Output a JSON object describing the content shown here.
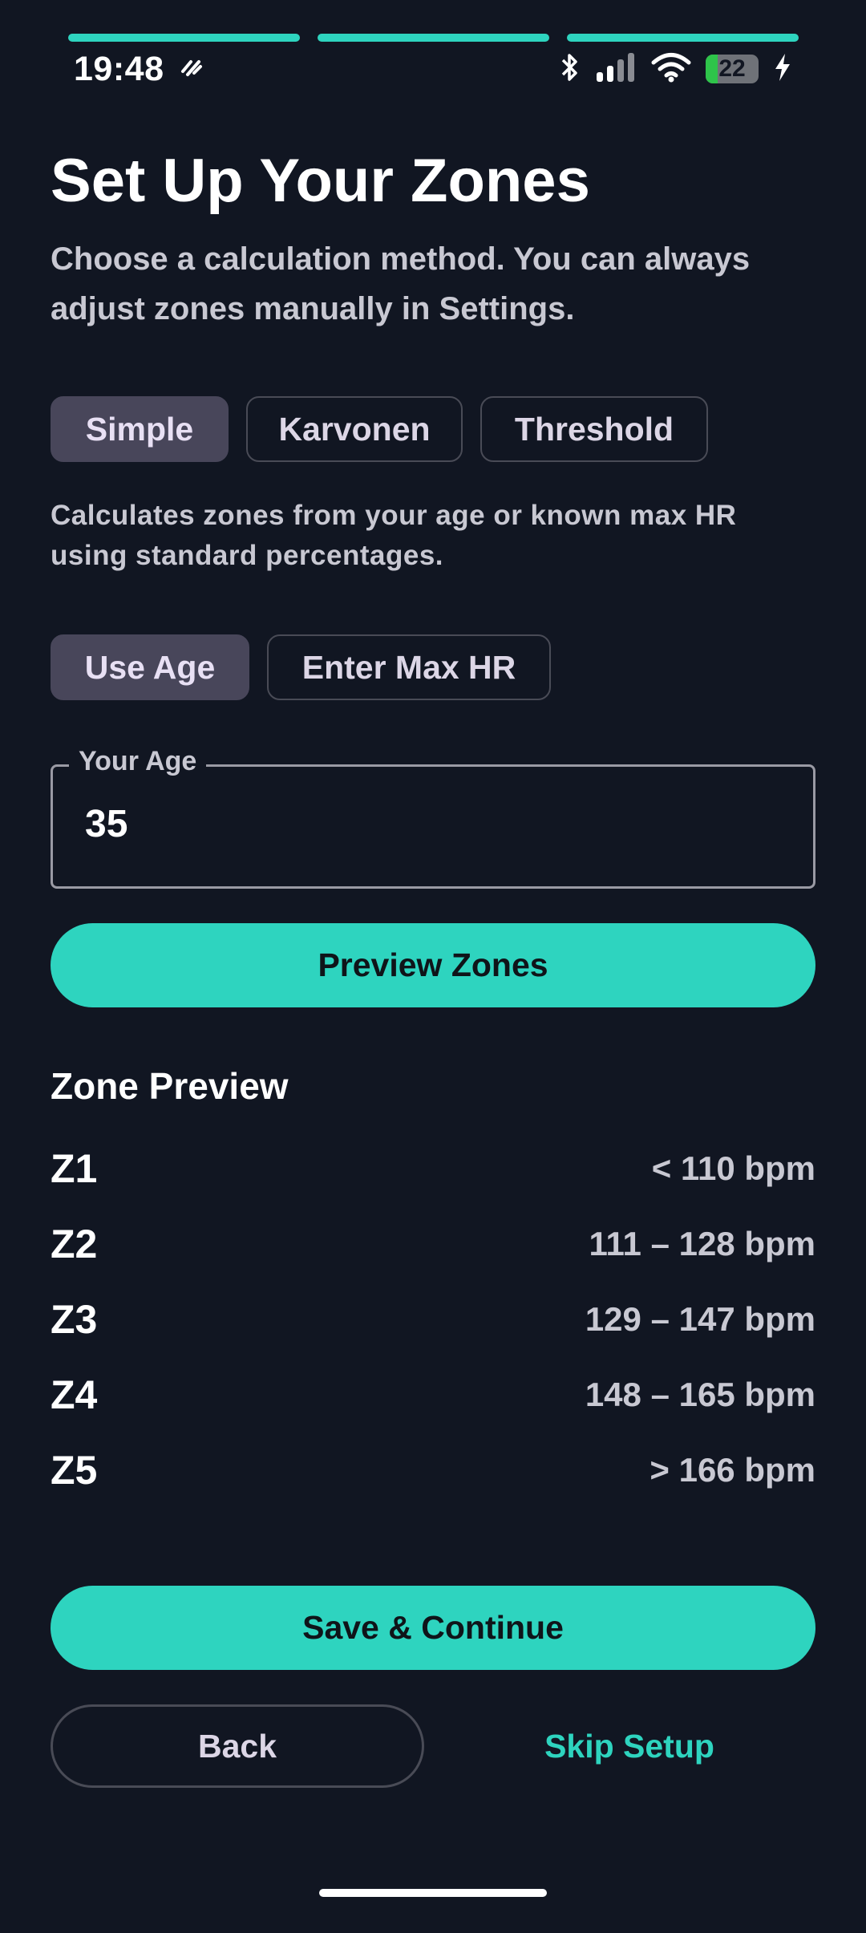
{
  "status_bar": {
    "time": "19:48",
    "battery": "22",
    "icons": [
      "notification-icon",
      "bluetooth-icon",
      "signal-icon",
      "wifi-icon",
      "battery-icon",
      "charging-icon"
    ]
  },
  "onboarding": {
    "steps_total": 3,
    "steps_completed": 3
  },
  "header": {
    "title": "Set Up Your Zones",
    "subtitle": "Choose a calculation method. You can always adjust zones manually in Settings."
  },
  "methods": {
    "selected": "Simple",
    "options": [
      "Simple",
      "Karvonen",
      "Threshold"
    ],
    "description": "Calculates zones from your age or known max HR using standard percentages."
  },
  "input_mode": {
    "selected": "Use Age",
    "options": [
      "Use Age",
      "Enter Max HR"
    ]
  },
  "age_field": {
    "label": "Your Age",
    "value": "35"
  },
  "preview_button": "Preview Zones",
  "zone_preview": {
    "title": "Zone Preview",
    "zones": [
      {
        "label": "Z1",
        "range": "< 110 bpm"
      },
      {
        "label": "Z2",
        "range": "111 – 128 bpm"
      },
      {
        "label": "Z3",
        "range": "129 – 147 bpm"
      },
      {
        "label": "Z4",
        "range": "148 – 165 bpm"
      },
      {
        "label": "Z5",
        "range": "> 166 bpm"
      }
    ]
  },
  "actions": {
    "save": "Save & Continue",
    "back": "Back",
    "skip": "Skip Setup"
  },
  "colors": {
    "background": "#111622",
    "accent": "#2ed4bf",
    "segment_active": "#48465a",
    "muted_text": "#c8c8d2"
  }
}
